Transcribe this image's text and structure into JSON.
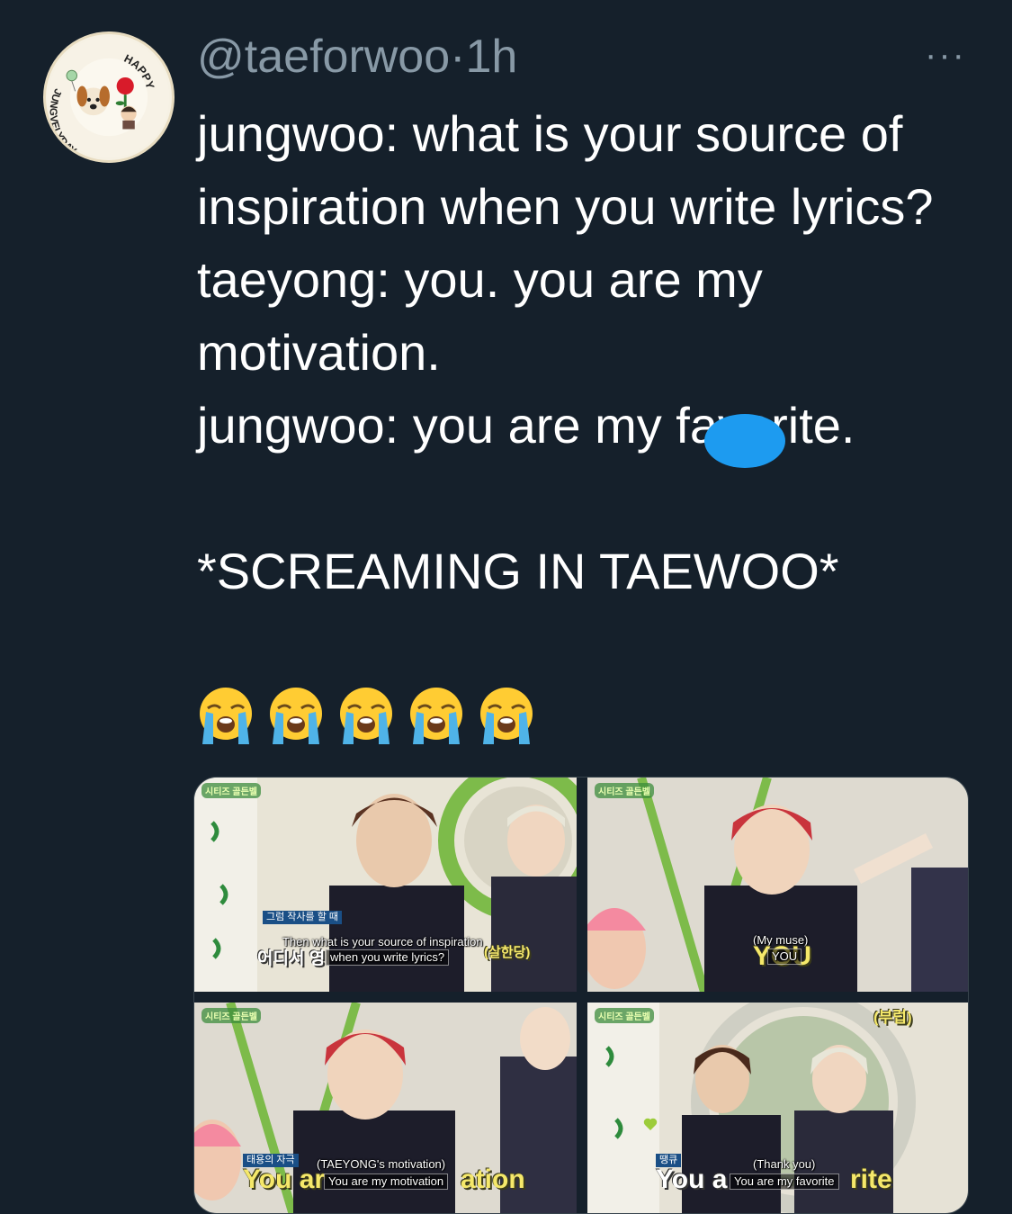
{
  "tweet": {
    "handle": "@taeforwoo",
    "separator": "·",
    "timestamp": "1h",
    "more_label": "···",
    "text": "jungwoo: what is your source of inspiration when you write lyrics?\ntaeyong: you. you are my motivation.\njungwoo: you are my favorite.\n\n*SCREAMING IN TAEWOO*",
    "emoji_count": 5,
    "emoji_name": "loudly-crying-face"
  },
  "avatar": {
    "top_text": "HAPPY",
    "side_text": "JUNGVELYDAY"
  },
  "media": {
    "tiles": [
      {
        "logo": "시티즈 골든벨",
        "korean_caption": "그럼 작사를 할 때",
        "sub_line1": "Then what is your source of inspiration",
        "sub_line2": "when you write lyrics?",
        "korean_big": "어디서 영",
        "korean_side": "(살한당)"
      },
      {
        "logo": "시티즈 골든벨",
        "sub_line1": "(My muse)",
        "sub_line2": "YOU",
        "big": "YOU"
      },
      {
        "logo": "시티즈 골든벨",
        "tag": "태용의 자극",
        "sub_line1": "(TAEYONG's motivation)",
        "sub_line2": "You are my motivation",
        "big_left": "You ar",
        "big_right": "ation"
      },
      {
        "logo": "시티즈 골든벨",
        "korean_top": "(부럽)",
        "tag": "땡큐",
        "sub_line1": "(Thank you)",
        "sub_line2": "You are my favorite",
        "big_left": "You a",
        "big_right": "rite"
      }
    ]
  },
  "colors": {
    "background": "#15202b",
    "secondary_text": "#8899a6",
    "accent": "#1d9bf0"
  }
}
